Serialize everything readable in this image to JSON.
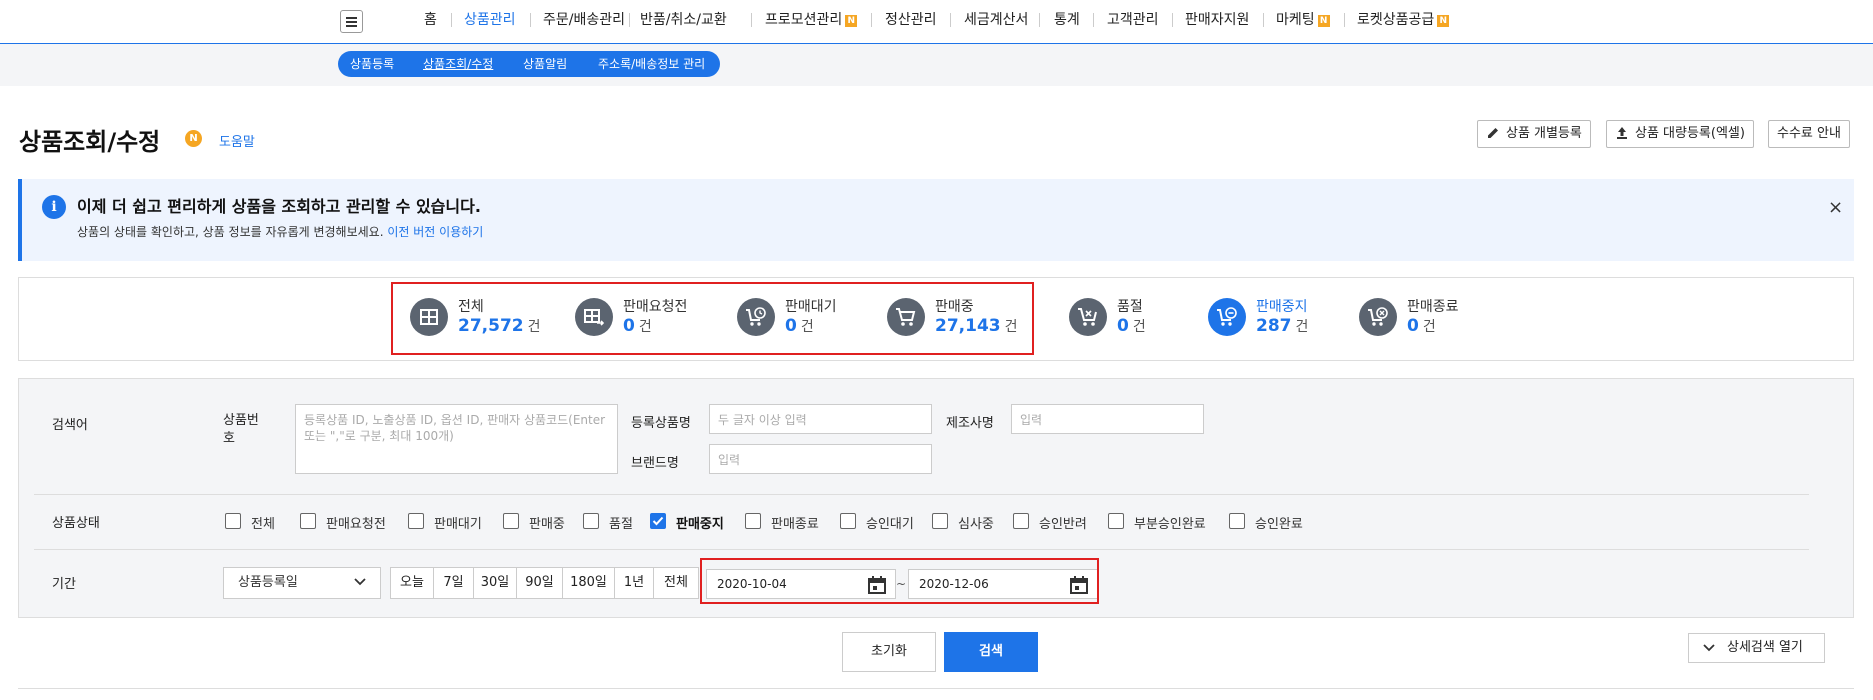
{
  "nav": {
    "items": [
      {
        "label": "홈"
      },
      {
        "label": "상품관리"
      },
      {
        "label": "주문/배송관리"
      },
      {
        "label": "반품/취소/교환"
      },
      {
        "label": "프로모션관리",
        "badge": "N"
      },
      {
        "label": "정산관리"
      },
      {
        "label": "세금계산서"
      },
      {
        "label": "통계"
      },
      {
        "label": "고객관리"
      },
      {
        "label": "판매자지원"
      },
      {
        "label": "마케팅",
        "badge": "N"
      },
      {
        "label": "로켓상품공급",
        "badge": "N"
      }
    ],
    "active": "상품관리"
  },
  "subnav": {
    "items": [
      {
        "label": "상품등록"
      },
      {
        "label": "상품조회/수정"
      },
      {
        "label": "상품알림"
      },
      {
        "label": "주소록/배송정보 관리"
      }
    ],
    "active": "상품조회/수정"
  },
  "header": {
    "title": "상품조회/수정",
    "badge": "N",
    "help": "도움말",
    "buttons": {
      "single_register": "상품 개별등록",
      "bulk_register": "상품 대량등록(엑셀)",
      "fee_guide": "수수료 안내"
    }
  },
  "notice": {
    "title": "이제 더 쉽고 편리하게 상품을 조회하고 관리할 수 있습니다.",
    "desc": "상품의 상태를 확인하고, 상품 정보를 자유롭게 변경해보세요.",
    "link": "이전 버전 이용하기",
    "close": "×"
  },
  "status": {
    "unit": "건",
    "items": [
      {
        "label": "전체",
        "count": "27,572"
      },
      {
        "label": "판매요청전",
        "count": "0"
      },
      {
        "label": "판매대기",
        "count": "0"
      },
      {
        "label": "판매중",
        "count": "27,143"
      },
      {
        "label": "품절",
        "count": "0"
      },
      {
        "label": "판매중지",
        "count": "287"
      },
      {
        "label": "판매종료",
        "count": "0"
      }
    ]
  },
  "search": {
    "keyword_label": "검색어",
    "product_no_label": "상품번호",
    "product_no_placeholder": "등록상품 ID, 노출상품 ID, 옵션 ID, 판매자 상품코드(Enter 또는 \",\"로 구분, 최대 100개)",
    "reg_name_label": "등록상품명",
    "reg_name_placeholder": "두 글자 이상 입력",
    "maker_label": "제조사명",
    "maker_placeholder": "입력",
    "brand_label": "브랜드명",
    "brand_placeholder": "입력",
    "status_label": "상품상태",
    "status_options": [
      {
        "label": "전체",
        "checked": false
      },
      {
        "label": "판매요청전",
        "checked": false
      },
      {
        "label": "판매대기",
        "checked": false
      },
      {
        "label": "판매중",
        "checked": false
      },
      {
        "label": "품절",
        "checked": false
      },
      {
        "label": "판매중지",
        "checked": true
      },
      {
        "label": "판매종료",
        "checked": false
      },
      {
        "label": "승인대기",
        "checked": false
      },
      {
        "label": "심사중",
        "checked": false
      },
      {
        "label": "승인반려",
        "checked": false
      },
      {
        "label": "부분승인완료",
        "checked": false
      },
      {
        "label": "승인완료",
        "checked": false
      }
    ],
    "period_label": "기간",
    "date_type": "상품등록일",
    "period_buttons": [
      "오늘",
      "7일",
      "30일",
      "90일",
      "180일",
      "1년",
      "전체"
    ],
    "start_date": "2020-10-04",
    "end_date": "2020-12-06",
    "tilde": "~",
    "reset": "초기화",
    "submit": "검색",
    "advanced": "상세검색 열기"
  },
  "colors": {
    "primary": "#1e74e8",
    "highlight": "#e02020",
    "badge": "#f5a623"
  }
}
